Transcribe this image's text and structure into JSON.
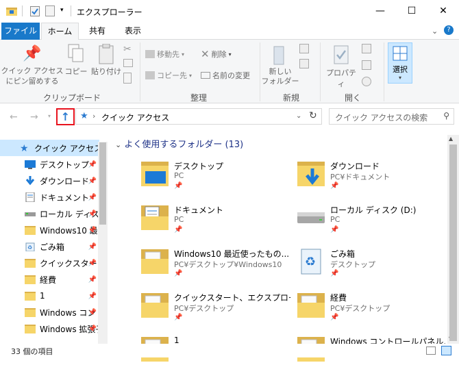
{
  "window": {
    "title": "エクスプローラー",
    "minimize": "—",
    "maximize": "☐",
    "close": "✕"
  },
  "ribbon_tabs": [
    "ファイル",
    "ホーム",
    "共有",
    "表示"
  ],
  "ribbon": {
    "clipboard": {
      "pin": "クイック アクセス\nにピン留めする",
      "copy": "コピー",
      "paste": "貼り付け",
      "label": "クリップボード"
    },
    "organize": {
      "move": "移動先",
      "delete": "削除",
      "copy_to": "コピー先",
      "rename": "名前の変更",
      "label": "整理"
    },
    "new": {
      "new_folder": "新しい\nフォルダー",
      "label": "新規"
    },
    "open": {
      "properties": "プロパティ",
      "label": "開く"
    },
    "select": {
      "select": "選択"
    }
  },
  "address": {
    "path": "クイック アクセス",
    "search_placeholder": "クイック アクセスの検索"
  },
  "nav": {
    "items": [
      {
        "label": "クイック アクセス",
        "icon": "star-icon",
        "selected": true
      },
      {
        "label": "デスクトップ",
        "icon": "desktop-icon"
      },
      {
        "label": "ダウンロード",
        "icon": "download-icon"
      },
      {
        "label": "ドキュメント",
        "icon": "document-icon"
      },
      {
        "label": "ローカル ディスク",
        "icon": "drive-icon"
      },
      {
        "label": "Windows10 最",
        "icon": "folder-icon"
      },
      {
        "label": "ごみ箱",
        "icon": "recycle-bin-icon"
      },
      {
        "label": "クイックスタート",
        "icon": "folder-icon"
      },
      {
        "label": "経費",
        "icon": "folder-icon"
      },
      {
        "label": "1",
        "icon": "folder-icon"
      },
      {
        "label": "Windows コントロ",
        "icon": "folder-icon"
      },
      {
        "label": "Windows 拡張子",
        "icon": "folder-icon"
      }
    ]
  },
  "content": {
    "group_header": "よく使用するフォルダー (13)",
    "tiles": [
      {
        "name": "デスクトップ",
        "sub": "PC",
        "icon": "desktop-folder-icon"
      },
      {
        "name": "ダウンロード",
        "sub": "PC¥ドキュメント",
        "icon": "download-folder-icon"
      },
      {
        "name": "ドキュメント",
        "sub": "PC",
        "icon": "document-folder-icon"
      },
      {
        "name": "ローカル ディスク (D:)",
        "sub": "PC",
        "icon": "drive-icon"
      },
      {
        "name": "Windows10 最近使ったもの...",
        "sub": "PC¥デスクトップ¥Windows10",
        "icon": "folder-icon"
      },
      {
        "name": "ごみ箱",
        "sub": "デスクトップ",
        "icon": "recycle-bin-icon"
      },
      {
        "name": "クイックスタート、エクスプロー...",
        "sub": "PC¥デスクトップ",
        "icon": "folder-icon"
      },
      {
        "name": "経費",
        "sub": "PC¥デスクトップ",
        "icon": "folder-icon"
      },
      {
        "name": "1",
        "sub": "",
        "icon": "folder-icon"
      },
      {
        "name": "Windows コントロールパネル...",
        "sub": "",
        "icon": "folder-icon"
      }
    ]
  },
  "status": {
    "count": "33 個の項目"
  },
  "colors": {
    "accent": "#1979ca",
    "highlight": "#e8131e",
    "selected_bg": "#cce8ff"
  }
}
